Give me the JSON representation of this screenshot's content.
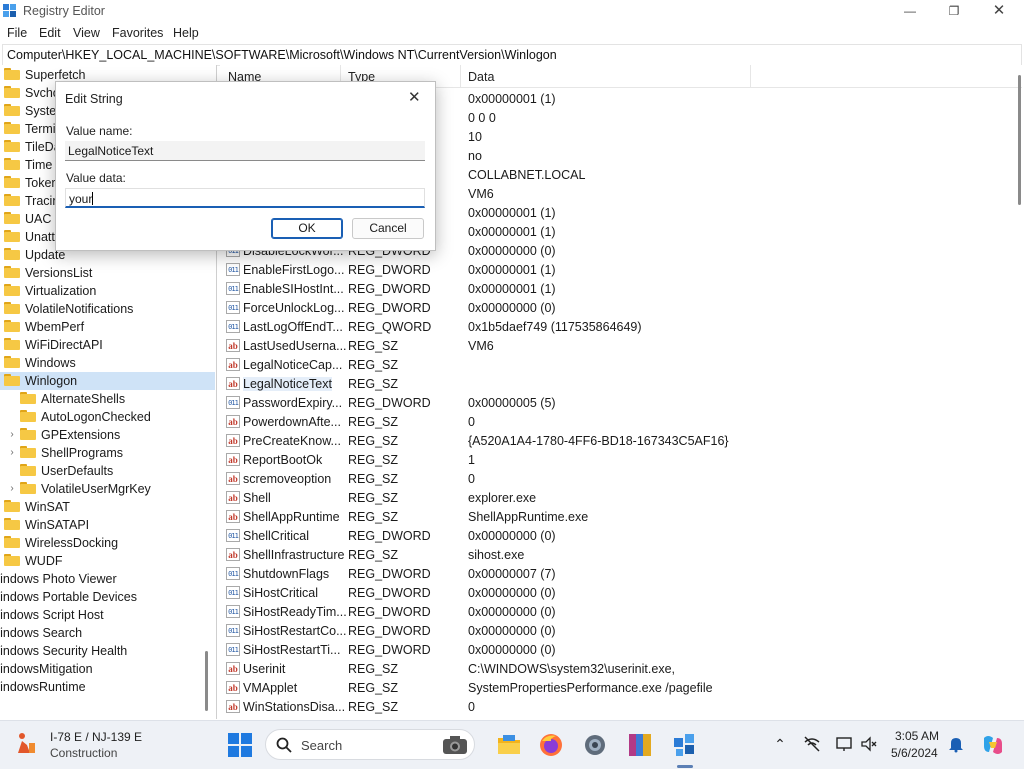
{
  "window": {
    "title": "Registry Editor"
  },
  "menu": [
    "File",
    "Edit",
    "View",
    "Favorites",
    "Help"
  ],
  "address": "Computer\\HKEY_LOCAL_MACHINE\\SOFTWARE\\Microsoft\\Windows NT\\CurrentVersion\\Winlogon",
  "tree": [
    {
      "label": "Superfetch",
      "level": 1
    },
    {
      "label": "Svcho",
      "level": 1
    },
    {
      "label": "Syste",
      "level": 1
    },
    {
      "label": "Termi",
      "level": 1
    },
    {
      "label": "TileDa",
      "level": 1
    },
    {
      "label": "Time",
      "level": 1
    },
    {
      "label": "Toker",
      "level": 1
    },
    {
      "label": "Tracin",
      "level": 1
    },
    {
      "label": "UAC",
      "level": 1
    },
    {
      "label": "Unatt",
      "level": 1
    },
    {
      "label": "Update",
      "level": 1
    },
    {
      "label": "VersionsList",
      "level": 1
    },
    {
      "label": "Virtualization",
      "level": 1
    },
    {
      "label": "VolatileNotifications",
      "level": 1
    },
    {
      "label": "WbemPerf",
      "level": 1
    },
    {
      "label": "WiFiDirectAPI",
      "level": 1
    },
    {
      "label": "Windows",
      "level": 1
    },
    {
      "label": "Winlogon",
      "level": 1,
      "selected": true
    },
    {
      "label": "AlternateShells",
      "level": 2
    },
    {
      "label": "AutoLogonChecked",
      "level": 2
    },
    {
      "label": "GPExtensions",
      "level": 2,
      "expander": true
    },
    {
      "label": "ShellPrograms",
      "level": 2,
      "expander": true
    },
    {
      "label": "UserDefaults",
      "level": 2
    },
    {
      "label": "VolatileUserMgrKey",
      "level": 2,
      "expander": true
    },
    {
      "label": "WinSAT",
      "level": 1
    },
    {
      "label": "WinSATAPI",
      "level": 1
    },
    {
      "label": "WirelessDocking",
      "level": 1
    },
    {
      "label": "WUDF",
      "level": 1
    },
    {
      "label": "Vindows Photo Viewer",
      "level": 0
    },
    {
      "label": "Vindows Portable Devices",
      "level": 0
    },
    {
      "label": "Vindows Script Host",
      "level": 0
    },
    {
      "label": "Vindows Search",
      "level": 0
    },
    {
      "label": "Vindows Security Health",
      "level": 0
    },
    {
      "label": "VindowsMitigation",
      "level": 0
    },
    {
      "label": "VindowsRuntime",
      "level": 0
    }
  ],
  "columns": [
    "Name",
    "Type",
    "Data"
  ],
  "values": [
    {
      "name": "",
      "type": "",
      "data": "0x00000001 (1)",
      "icon": ""
    },
    {
      "name": "",
      "type": "",
      "data": "0 0 0",
      "icon": ""
    },
    {
      "name": "",
      "type": "",
      "data": "10",
      "icon": ""
    },
    {
      "name": "",
      "type": "",
      "data": "no",
      "icon": ""
    },
    {
      "name": "",
      "type": "",
      "data": "COLLABNET.LOCAL",
      "icon": ""
    },
    {
      "name": "",
      "type": "",
      "data": "VM6",
      "icon": ""
    },
    {
      "name": "",
      "type": "",
      "data": "0x00000001 (1)",
      "icon": ""
    },
    {
      "name": "",
      "type": "",
      "data": "0x00000001 (1)",
      "icon": ""
    },
    {
      "name": "DisableLockWor...",
      "type": "REG_DWORD",
      "data": "0x00000000 (0)",
      "icon": "dword"
    },
    {
      "name": "EnableFirstLogo...",
      "type": "REG_DWORD",
      "data": "0x00000001 (1)",
      "icon": "dword"
    },
    {
      "name": "EnableSIHostInt...",
      "type": "REG_DWORD",
      "data": "0x00000001 (1)",
      "icon": "dword"
    },
    {
      "name": "ForceUnlockLog...",
      "type": "REG_DWORD",
      "data": "0x00000000 (0)",
      "icon": "dword"
    },
    {
      "name": "LastLogOffEndT...",
      "type": "REG_QWORD",
      "data": "0x1b5daef749 (117535864649)",
      "icon": "dword"
    },
    {
      "name": "LastUsedUserna...",
      "type": "REG_SZ",
      "data": "VM6",
      "icon": "sz"
    },
    {
      "name": "LegalNoticeCap...",
      "type": "REG_SZ",
      "data": "",
      "icon": "sz"
    },
    {
      "name": "LegalNoticeText",
      "type": "REG_SZ",
      "data": "",
      "icon": "sz",
      "selected": true
    },
    {
      "name": "PasswordExpiry...",
      "type": "REG_DWORD",
      "data": "0x00000005 (5)",
      "icon": "dword"
    },
    {
      "name": "PowerdownAfte...",
      "type": "REG_SZ",
      "data": "0",
      "icon": "sz"
    },
    {
      "name": "PreCreateKnow...",
      "type": "REG_SZ",
      "data": "{A520A1A4-1780-4FF6-BD18-167343C5AF16}",
      "icon": "sz"
    },
    {
      "name": "ReportBootOk",
      "type": "REG_SZ",
      "data": "1",
      "icon": "sz"
    },
    {
      "name": "scremoveoption",
      "type": "REG_SZ",
      "data": "0",
      "icon": "sz"
    },
    {
      "name": "Shell",
      "type": "REG_SZ",
      "data": "explorer.exe",
      "icon": "sz"
    },
    {
      "name": "ShellAppRuntime",
      "type": "REG_SZ",
      "data": "ShellAppRuntime.exe",
      "icon": "sz"
    },
    {
      "name": "ShellCritical",
      "type": "REG_DWORD",
      "data": "0x00000000 (0)",
      "icon": "dword"
    },
    {
      "name": "ShellInfrastructure",
      "type": "REG_SZ",
      "data": "sihost.exe",
      "icon": "sz"
    },
    {
      "name": "ShutdownFlags",
      "type": "REG_DWORD",
      "data": "0x00000007 (7)",
      "icon": "dword"
    },
    {
      "name": "SiHostCritical",
      "type": "REG_DWORD",
      "data": "0x00000000 (0)",
      "icon": "dword"
    },
    {
      "name": "SiHostReadyTim...",
      "type": "REG_DWORD",
      "data": "0x00000000 (0)",
      "icon": "dword"
    },
    {
      "name": "SiHostRestartCo...",
      "type": "REG_DWORD",
      "data": "0x00000000 (0)",
      "icon": "dword"
    },
    {
      "name": "SiHostRestartTi...",
      "type": "REG_DWORD",
      "data": "0x00000000 (0)",
      "icon": "dword"
    },
    {
      "name": "Userinit",
      "type": "REG_SZ",
      "data": "C:\\WINDOWS\\system32\\userinit.exe,",
      "icon": "sz"
    },
    {
      "name": "VMApplet",
      "type": "REG_SZ",
      "data": "SystemPropertiesPerformance.exe /pagefile",
      "icon": "sz"
    },
    {
      "name": "WinStationsDisa...",
      "type": "REG_SZ",
      "data": "0",
      "icon": "sz"
    }
  ],
  "dialog": {
    "title": "Edit String",
    "name_label": "Value name:",
    "name_value": "LegalNoticeText",
    "data_label": "Value data:",
    "data_value": "your",
    "ok": "OK",
    "cancel": "Cancel"
  },
  "taskbar": {
    "weather_line1": "I-78 E / NJ-139 E",
    "weather_line2": "Construction",
    "search_label": "Search",
    "time": "3:05 AM",
    "date": "5/6/2024"
  },
  "colors": {
    "accent": "#1a5fb4",
    "folder": "#f6c844",
    "selection": "#cfe3f7"
  }
}
